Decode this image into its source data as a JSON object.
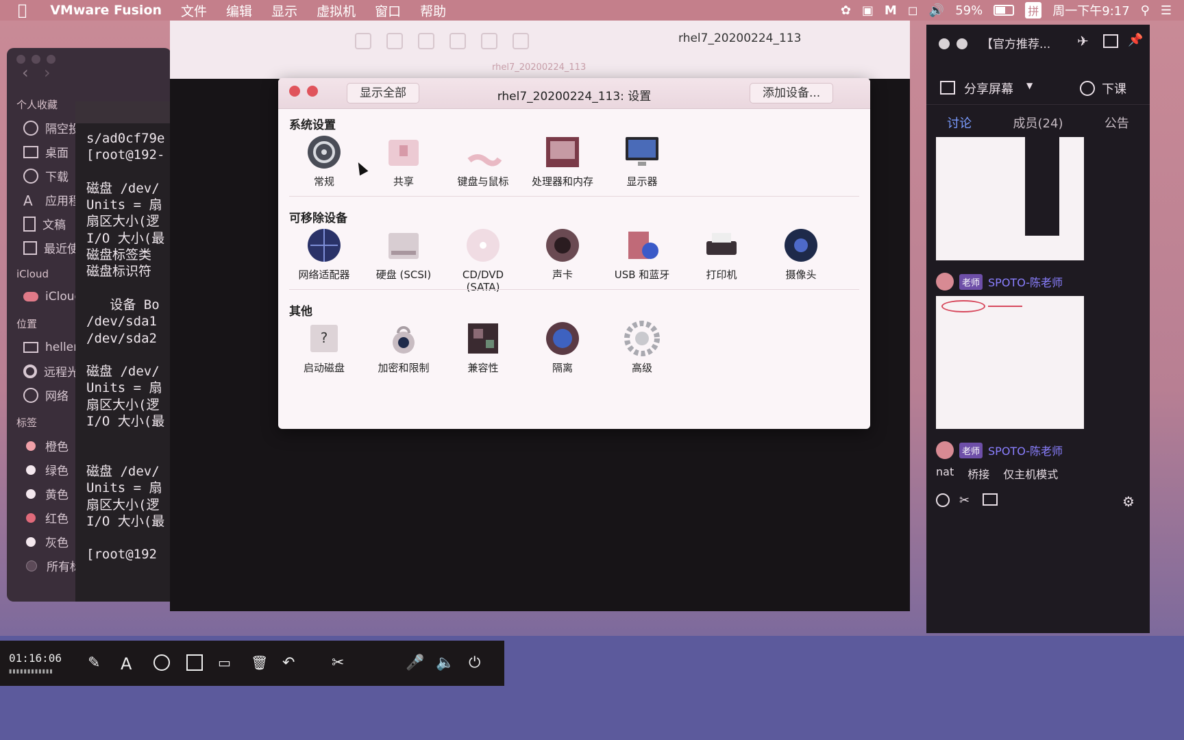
{
  "menubar": {
    "app_name": "VMware Fusion",
    "menus": [
      "文件",
      "编辑",
      "显示",
      "虚拟机",
      "窗口",
      "帮助"
    ],
    "battery": "59%",
    "input_method": "拼",
    "clock": "周一下午9:17"
  },
  "finder": {
    "favorites_header": "个人收藏",
    "favorites": [
      "隔空投",
      "桌面",
      "下载",
      "应用程",
      "文稿",
      "最近使"
    ],
    "icloud_header": "iCloud",
    "icloud_items": [
      "iCloud"
    ],
    "locations_header": "位置",
    "locations": [
      "hellen",
      "远程光",
      "网络"
    ],
    "tags_header": "标签",
    "tags": [
      {
        "label": "橙色",
        "color": "#f0a0a8"
      },
      {
        "label": "绿色",
        "color": "#f4e8ee"
      },
      {
        "label": "黄色",
        "color": "#f4e8ee"
      },
      {
        "label": "红色",
        "color": "#e06a7a"
      },
      {
        "label": "灰色",
        "color": "#f4e8ee"
      },
      {
        "label": "所有标",
        "color": "#5c4a58"
      }
    ]
  },
  "terminal": {
    "lines": [
      "s/ad0cf79e",
      "[root@192-",
      "",
      "磁盘 /dev/",
      "Units = 扇",
      "扇区大小(逻",
      "I/O 大小(最",
      "磁盘标签类",
      "磁盘标识符",
      "",
      "   设备 Bo",
      "/dev/sda1",
      "/dev/sda2",
      "",
      "磁盘 /dev/",
      "Units = 扇",
      "扇区大小(逻",
      "I/O 大小(最",
      "",
      "",
      "磁盘 /dev/",
      "Units = 扇",
      "扇区大小(逻",
      "I/O 大小(最",
      "",
      "[root@192"
    ]
  },
  "vmware": {
    "title": "rhel7_20200224_113",
    "subtitle": "rhel7_20200224_113"
  },
  "settings": {
    "show_all": "显示全部",
    "title": "rhel7_20200224_113: 设置",
    "add_device": "添加设备...",
    "sections": [
      {
        "title": "系统设置",
        "panes": [
          "常规",
          "共享",
          "键盘与鼠标",
          "处理器和内存",
          "显示器"
        ]
      },
      {
        "title": "可移除设备",
        "panes": [
          "网络适配器",
          "硬盘 (SCSI)",
          "CD/DVD\n(SATA)",
          "声卡",
          "USB 和蓝牙",
          "打印机",
          "摄像头"
        ]
      },
      {
        "title": "其他",
        "panes": [
          "启动磁盘",
          "加密和限制",
          "兼容性",
          "隔离",
          "高级"
        ]
      }
    ]
  },
  "chat": {
    "title": "【官方推荐...",
    "share_screen": "分享屏幕",
    "end_class": "下课",
    "tabs": [
      "讨论",
      "成员(24)",
      "公告"
    ],
    "active_tab": "讨论",
    "messages": [
      {
        "role": "老师",
        "sender": "SPOTO-陈老师"
      },
      {
        "role": "老师",
        "sender": "SPOTO-陈老师"
      }
    ],
    "last_message_words": [
      "nat",
      "桥接",
      "仅主机模式"
    ]
  },
  "recorder": {
    "elapsed": "01:16:06"
  }
}
